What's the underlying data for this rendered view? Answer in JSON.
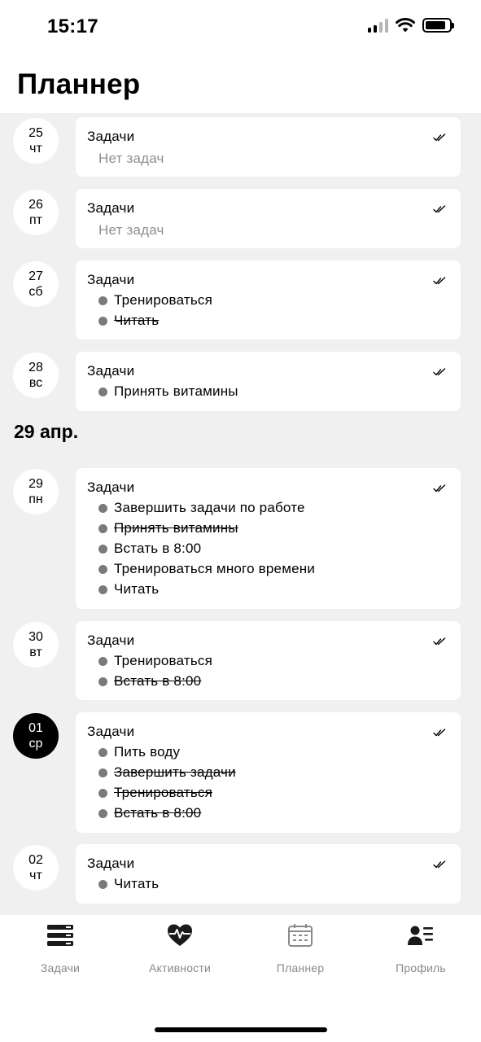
{
  "status_bar": {
    "time": "15:17",
    "icons": [
      "cellular-signal-icon",
      "wifi-icon",
      "battery-icon"
    ]
  },
  "page": {
    "title": "Планнер"
  },
  "card_title": "Задачи",
  "days": [
    {
      "day": "25",
      "weekday": "чт",
      "active": false,
      "empty_text": "Нет задач",
      "tasks": []
    },
    {
      "day": "26",
      "weekday": "пт",
      "active": false,
      "empty_text": "Нет задач",
      "tasks": []
    },
    {
      "day": "27",
      "weekday": "сб",
      "active": false,
      "tasks": [
        {
          "text": "Тренироваться",
          "done": false
        },
        {
          "text": "Читать",
          "done": true
        }
      ]
    },
    {
      "day": "28",
      "weekday": "вс",
      "active": false,
      "tasks": [
        {
          "text": "Принять витамины",
          "done": false
        }
      ]
    },
    {
      "month_header": "29 апр."
    },
    {
      "day": "29",
      "weekday": "пн",
      "active": false,
      "tasks": [
        {
          "text": "Завершить задачи по работе",
          "done": false
        },
        {
          "text": "Принять витамины",
          "done": true
        },
        {
          "text": "Встать в 8:00",
          "done": false
        },
        {
          "text": "Тренироваться много времени",
          "done": false
        },
        {
          "text": "Читать",
          "done": false
        }
      ]
    },
    {
      "day": "30",
      "weekday": "вт",
      "active": false,
      "tasks": [
        {
          "text": "Тренироваться",
          "done": false
        },
        {
          "text": "Встать в 8:00",
          "done": true
        }
      ]
    },
    {
      "day": "01",
      "weekday": "ср",
      "active": true,
      "tasks": [
        {
          "text": "Пить воду",
          "done": false
        },
        {
          "text": "Завершить задачи",
          "done": true
        },
        {
          "text": "Тренироваться",
          "done": true
        },
        {
          "text": "Встать в 8:00",
          "done": true
        }
      ]
    },
    {
      "day": "02",
      "weekday": "чт",
      "active": false,
      "tasks": [
        {
          "text": "Читать",
          "done": false
        }
      ]
    }
  ],
  "tabbar": {
    "tabs": [
      {
        "label": "Задачи",
        "icon": "tasks-stack-icon"
      },
      {
        "label": "Активности",
        "icon": "heart-pulse-icon"
      },
      {
        "label": "Планнер",
        "icon": "calendar-icon"
      },
      {
        "label": "Профиль",
        "icon": "profile-list-icon"
      }
    ]
  }
}
